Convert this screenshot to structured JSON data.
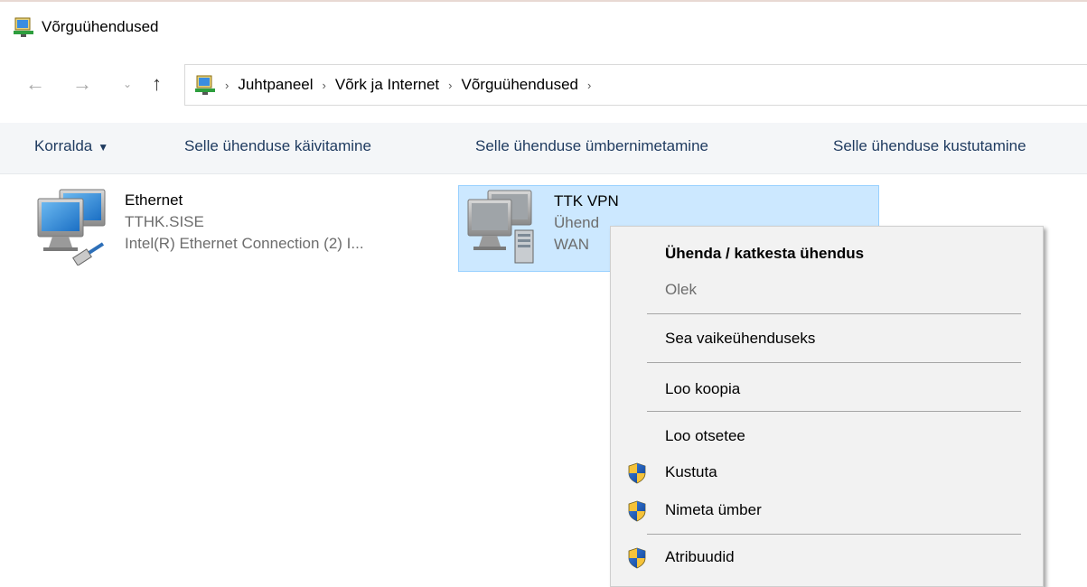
{
  "window": {
    "title": "Võrguühendused",
    "icon": "network-connections-icon"
  },
  "nav": {
    "back_icon": "back-arrow-icon",
    "forward_icon": "forward-arrow-icon",
    "recent_icon": "chevron-down-icon",
    "up_icon": "up-arrow-icon",
    "breadcrumbs": [
      "Juhtpaneel",
      "Võrk ja Internet",
      "Võrguühendused"
    ]
  },
  "toolbar": {
    "organize": "Korralda",
    "start": "Selle ühenduse käivitamine",
    "rename": "Selle ühenduse ümbernimetamine",
    "delete": "Selle ühenduse kustutamine"
  },
  "connections": [
    {
      "name": "Ethernet",
      "line1": "TTHK.SISE",
      "line2": "Intel(R) Ethernet Connection (2) I...",
      "icon": "ethernet-adapter-icon",
      "selected": false
    },
    {
      "name": "TTK VPN",
      "line1": "Ühend",
      "line2": "WAN",
      "icon": "vpn-adapter-icon",
      "selected": true
    }
  ],
  "context_menu": {
    "items": [
      {
        "label": "Ühenda / katkesta ühendus",
        "bold": true
      },
      {
        "label": "Olek",
        "disabled": true
      },
      {
        "label": "Sea vaikeühenduseks"
      },
      {
        "label": "Loo koopia"
      },
      {
        "label": "Loo otsetee"
      },
      {
        "label": "Kustuta",
        "icon": "uac-shield-icon"
      },
      {
        "label": "Nimeta ümber",
        "icon": "uac-shield-icon"
      },
      {
        "label": "Atribuudid",
        "icon": "uac-shield-icon"
      }
    ]
  },
  "colors": {
    "selection_bg": "#cce8ff",
    "selection_border": "#99d1ff",
    "command_text": "#1e3a5f",
    "menu_bg": "#f2f2f2"
  }
}
